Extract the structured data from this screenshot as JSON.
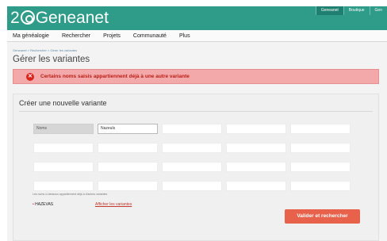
{
  "header": {
    "logo_text_left": "2",
    "logo_text_right": "Geneanet",
    "top_links": [
      "Geneanet",
      "Boutique",
      "Gen"
    ]
  },
  "nav": {
    "items": [
      "Ma généalogie",
      "Rechercher",
      "Projets",
      "Communauté",
      "Plus"
    ]
  },
  "breadcrumb": "Geneanet > Rechercher > Gérer les variantes",
  "page_title": "Gérer les variantes",
  "alert": {
    "text": "Certains noms saisis appartiennent déjà à une autre variante"
  },
  "form": {
    "title": "Créer une nouvelle variante",
    "first_label": "Noms",
    "first_value": "Nazeuls",
    "hint": "Les noms ci-dessous appartiennent déjà à d'autres variantes",
    "variant_name": "HAZEVAS",
    "show_link": "Afficher les variantes",
    "submit_label": "Valider et rechercher"
  },
  "colors": {
    "header": "#2f9b89",
    "alert_bg": "#f3a9aa",
    "alert_text": "#bb1c14",
    "submit": "#e8614a"
  }
}
